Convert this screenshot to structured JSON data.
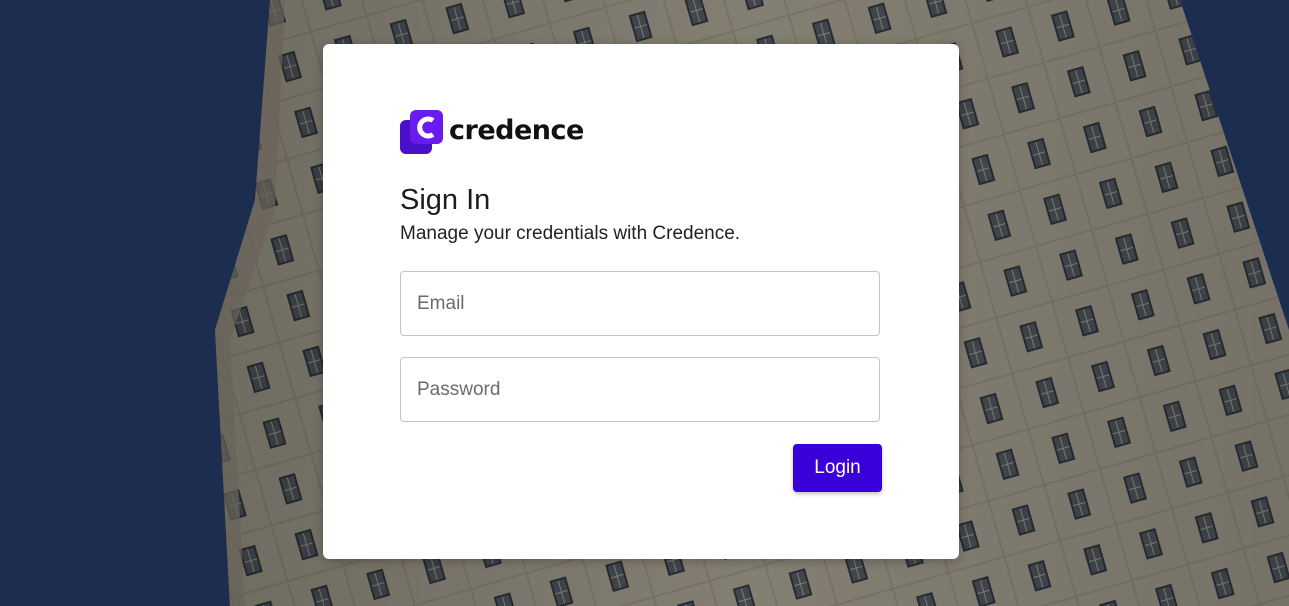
{
  "brand": {
    "name": "credence",
    "logo_icon": "credence-c-logo-icon",
    "colors": {
      "logo_purple": "#6a1bf0",
      "logo_purple_dark": "#4a10c9",
      "button": "#3a00d9",
      "background_sky": "#1f3055"
    }
  },
  "signin": {
    "title": "Sign In",
    "subtitle": "Manage your credentials with Credence.",
    "email_placeholder": "Email",
    "password_placeholder": "Password",
    "login_label": "Login"
  }
}
